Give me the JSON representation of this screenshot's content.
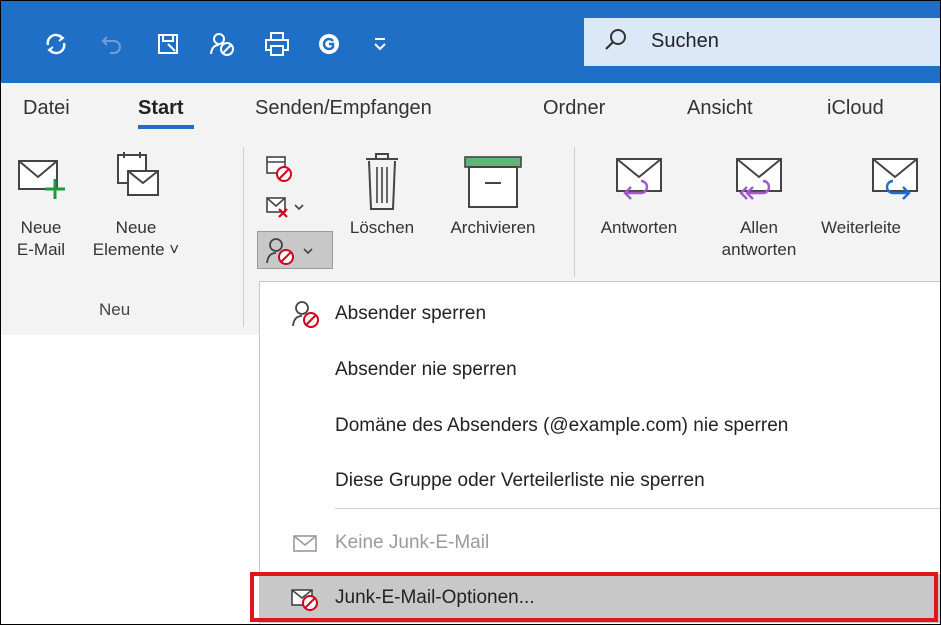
{
  "search": {
    "label": "Suchen"
  },
  "tabs": [
    {
      "label": "Datei"
    },
    {
      "label": "Start"
    },
    {
      "label": "Senden/Empfangen"
    },
    {
      "label": "Ordner"
    },
    {
      "label": "Ansicht"
    },
    {
      "label": "iCloud"
    }
  ],
  "ribbon": {
    "new_email": [
      "Neue",
      "E-Mail"
    ],
    "new_items": [
      "Neue",
      "Elemente ˅"
    ],
    "group_new": "Neu",
    "delete": "Löschen",
    "archive": "Archivieren",
    "reply": "Antworten",
    "reply_all": [
      "Allen",
      "antworten"
    ],
    "forward": "Weiterleite"
  },
  "menu": {
    "items": [
      {
        "label": "Absender sperren",
        "icon": "block-sender-icon"
      },
      {
        "label": "Absender nie sperren"
      },
      {
        "label": "Domäne des Absenders (@example.com) nie sperren"
      },
      {
        "label": "Diese Gruppe oder Verteilerliste nie sperren"
      },
      {
        "label": "Keine Junk-E-Mail",
        "icon": "envelope-icon",
        "disabled": true
      },
      {
        "label": "Junk-E-Mail-Optionen...",
        "icon": "junk-options-icon"
      }
    ]
  },
  "colors": {
    "titlebar": "#1f6fc6",
    "highlight_box": "#e0141a"
  }
}
